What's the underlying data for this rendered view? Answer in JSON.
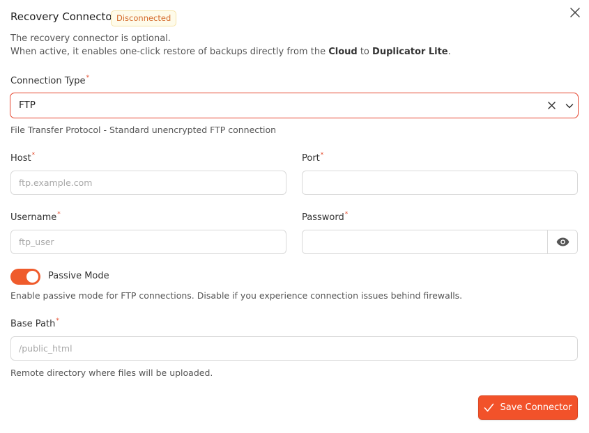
{
  "header": {
    "title": "Recovery Connector",
    "status_badge": "Disconnected"
  },
  "intro": {
    "line1": "The recovery connector is optional.",
    "line2_prefix": "When active, it enables one-click restore of backups directly from the ",
    "line2_cloud": "Cloud",
    "line2_to": " to ",
    "line2_product": "Duplicator Lite",
    "line2_suffix": "."
  },
  "connection_type": {
    "label": "Connection Type",
    "required_mark": "*",
    "value": "FTP",
    "help": "File Transfer Protocol - Standard unencrypted FTP connection"
  },
  "host": {
    "label": "Host",
    "required_mark": "*",
    "value": "",
    "placeholder": "ftp.example.com"
  },
  "port": {
    "label": "Port",
    "required_mark": "*",
    "value": "",
    "placeholder": ""
  },
  "username": {
    "label": "Username",
    "required_mark": "*",
    "value": "",
    "placeholder": "ftp_user"
  },
  "password": {
    "label": "Password",
    "required_mark": "*",
    "value": "",
    "placeholder": ""
  },
  "passive_mode": {
    "label": "Passive Mode",
    "enabled": true,
    "help": "Enable passive mode for FTP connections. Disable if you experience connection issues behind firewalls."
  },
  "base_path": {
    "label": "Base Path",
    "required_mark": "*",
    "value": "",
    "placeholder": "/public_html",
    "help": "Remote directory where files will be uploaded."
  },
  "actions": {
    "save_label": "Save Connector"
  },
  "icons": {
    "close": "close-icon",
    "clear": "clear-icon",
    "dropdown": "chevron-down-icon",
    "show_password": "eye-icon",
    "save": "check-icon"
  },
  "colors": {
    "accent": "#f2522a",
    "error_border": "#e5442d",
    "badge_text": "#d4692a",
    "badge_bg": "#fefbea"
  }
}
